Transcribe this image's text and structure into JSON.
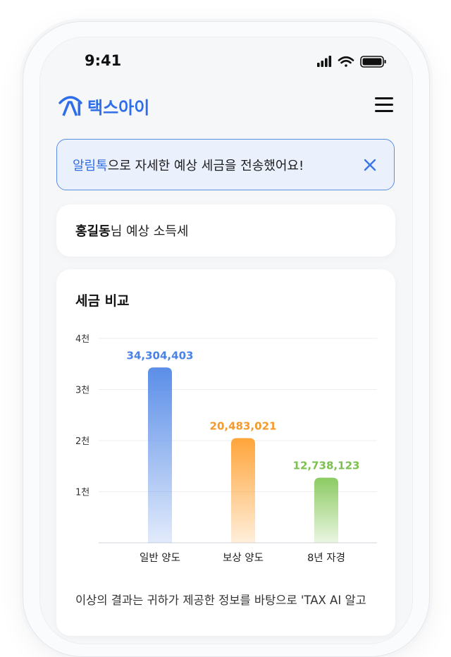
{
  "status_bar": {
    "time": "9:41"
  },
  "header": {
    "logo_text": "택스아이",
    "logo_icon": "ai-logo-icon",
    "menu_icon": "hamburger-menu-icon"
  },
  "banner": {
    "highlight": "알림톡",
    "text": "으로 자세한 예상 세금을 전송했어요!",
    "close_icon": "close-icon"
  },
  "summary": {
    "name": "홍길동",
    "suffix": "님 예상 소득세"
  },
  "chart_section": {
    "title": "세금 비교"
  },
  "chart_data": {
    "type": "bar",
    "title": "세금 비교",
    "categories": [
      "일반 양도",
      "보상 양도",
      "8년 자경"
    ],
    "values": [
      34304403,
      20483021,
      12738123
    ],
    "value_labels": [
      "34,304,403",
      "20,483,021",
      "12,738,123"
    ],
    "y_ticks": [
      {
        "value": 10000000,
        "label": "1천"
      },
      {
        "value": 20000000,
        "label": "2천"
      },
      {
        "value": 30000000,
        "label": "3천"
      },
      {
        "value": 40000000,
        "label": "4천"
      }
    ],
    "ylim": [
      0,
      40000000
    ],
    "colors": [
      "#5b8ee8",
      "#ffa53a",
      "#8ccb62"
    ],
    "label_colors": [
      "#4a82e6",
      "#f59a2a",
      "#7cc14f"
    ],
    "grid": true
  },
  "footer_text": "이상의 결과는 귀하가 제공한 정보를 바탕으로 'TAX AI 알고"
}
